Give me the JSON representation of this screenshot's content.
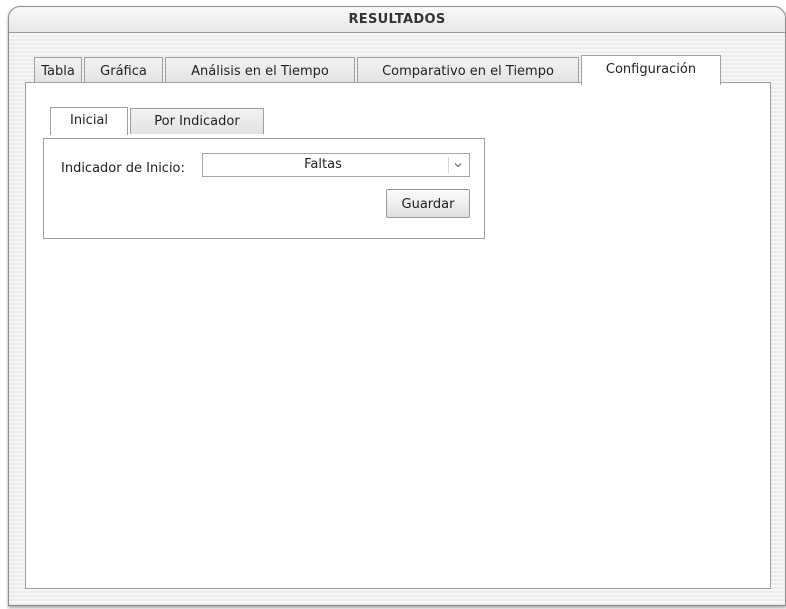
{
  "window": {
    "title": "RESULTADOS"
  },
  "main_tabs": [
    {
      "label": "Tabla",
      "active": false
    },
    {
      "label": "Gráfica",
      "active": false
    },
    {
      "label": "Análisis en el Tiempo",
      "active": false
    },
    {
      "label": "Comparativo en el Tiempo",
      "active": false
    },
    {
      "label": "Configuración",
      "active": true
    }
  ],
  "sub_tabs": [
    {
      "label": "Inicial",
      "active": true
    },
    {
      "label": "Por Indicador",
      "active": false
    }
  ],
  "form": {
    "start_indicator_label": "Indicador de Inicio:",
    "start_indicator_value": "Faltas",
    "dropdown_icon": "chevron-down-icon",
    "save_label": "Guardar"
  }
}
